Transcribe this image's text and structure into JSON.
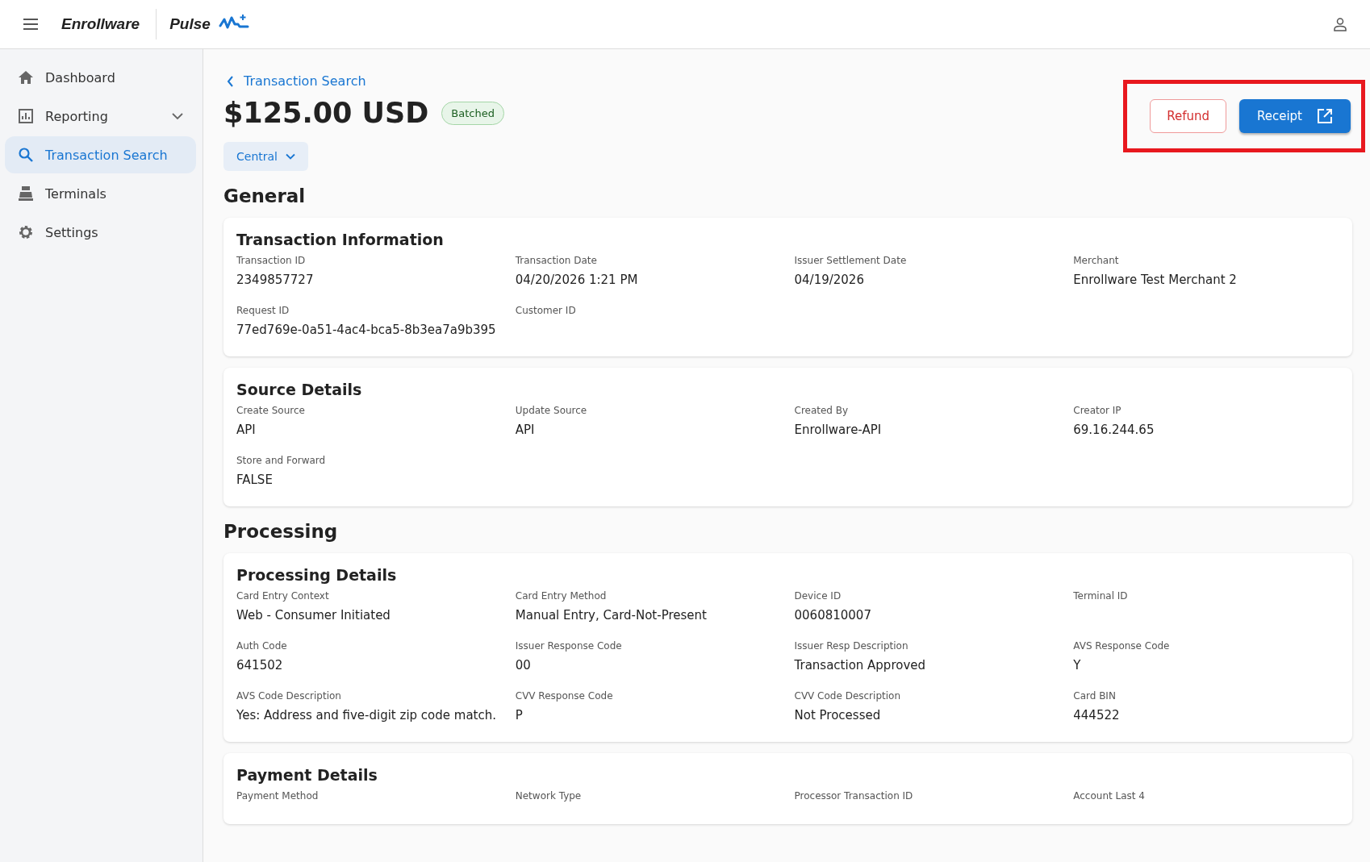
{
  "header": {
    "brand": "Enrollware",
    "product": "Pulse"
  },
  "sidebar": {
    "items": [
      {
        "label": "Dashboard",
        "selected": false,
        "expandable": false
      },
      {
        "label": "Reporting",
        "selected": false,
        "expandable": true
      },
      {
        "label": "Transaction Search",
        "selected": true,
        "expandable": false
      },
      {
        "label": "Terminals",
        "selected": false,
        "expandable": false
      },
      {
        "label": "Settings",
        "selected": false,
        "expandable": false
      }
    ]
  },
  "breadcrumb": "Transaction Search",
  "title": "$125.00 USD",
  "status_badge": "Batched",
  "location_dropdown": "Central",
  "actions": [
    {
      "label": "Refund",
      "kind": "outline"
    },
    {
      "label": "Receipt",
      "kind": "primary"
    }
  ],
  "sections": [
    {
      "heading": "General",
      "cards": [
        {
          "title": "Transaction Information",
          "fields": [
            {
              "label": "Transaction ID",
              "value": "2349857727"
            },
            {
              "label": "Transaction Date",
              "value": "04/20/2026 1:21 PM"
            },
            {
              "label": "Issuer Settlement Date",
              "value": "04/19/2026"
            },
            {
              "label": "Merchant",
              "value": "Enrollware Test Merchant 2"
            },
            {
              "label": "Request ID",
              "value": "77ed769e-0a51-4ac4-bca5-8b3ea7a9b395"
            },
            {
              "label": "Customer ID"
            }
          ]
        },
        {
          "title": "Source Details",
          "fields": [
            {
              "label": "Create Source",
              "value": "API"
            },
            {
              "label": "Update Source",
              "value": "API"
            },
            {
              "label": "Created By",
              "value": "Enrollware-API"
            },
            {
              "label": "Creator IP",
              "value": "69.16.244.65"
            },
            {
              "label": "Store and Forward",
              "value": "FALSE"
            }
          ]
        }
      ]
    },
    {
      "heading": "Processing",
      "cards": [
        {
          "title": "Processing Details",
          "fields": [
            {
              "label": "Card Entry Context",
              "value": "Web - Consumer Initiated"
            },
            {
              "label": "Card Entry Method",
              "value": "Manual Entry, Card-Not-Present"
            },
            {
              "label": "Device ID",
              "value": "0060810007"
            },
            {
              "label": "Terminal ID"
            },
            {
              "label": "Auth Code",
              "value": "641502"
            },
            {
              "label": "Issuer Response Code",
              "value": "00"
            },
            {
              "label": "Issuer Resp Description",
              "value": "Transaction Approved"
            },
            {
              "label": "AVS Response Code",
              "value": "Y"
            },
            {
              "label": "AVS Code Description",
              "value": "Yes: Address and five-digit zip code match."
            },
            {
              "label": "CVV Response Code",
              "value": "P"
            },
            {
              "label": "CVV Code Description",
              "value": "Not Processed"
            },
            {
              "label": "Card BIN",
              "value": "444522"
            }
          ]
        },
        {
          "title": "Payment Details",
          "fields": [
            {
              "label": "Payment Method"
            },
            {
              "label": "Network Type"
            },
            {
              "label": "Processor Transaction ID"
            },
            {
              "label": "Account Last 4"
            }
          ]
        }
      ]
    }
  ]
}
